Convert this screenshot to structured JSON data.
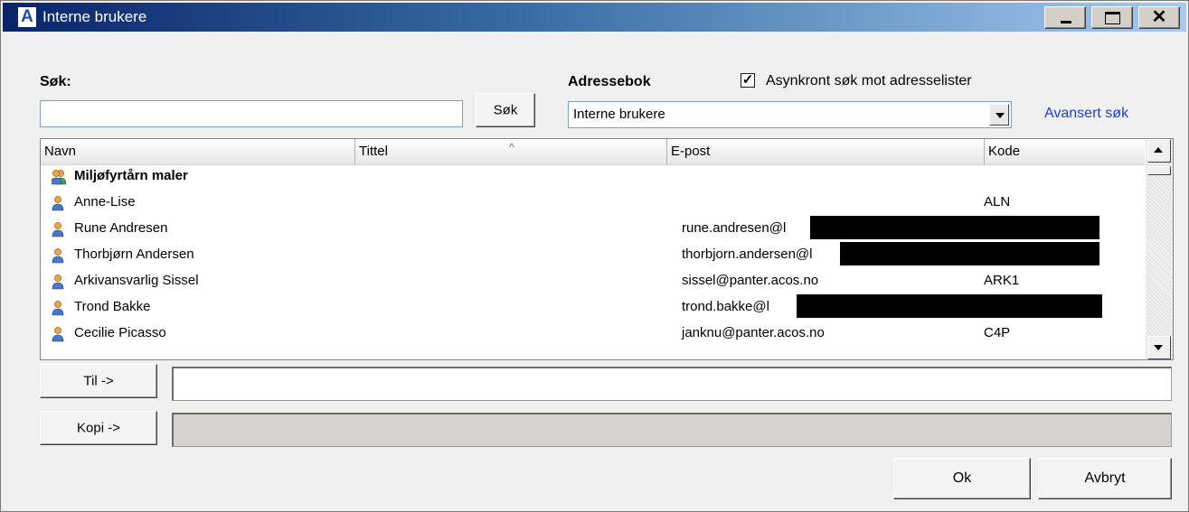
{
  "window": {
    "title": "Interne brukere",
    "icon": "acos-app-icon",
    "controls": {
      "minimize": "minimize-icon",
      "maximize": "maximize-icon",
      "close": "close-icon"
    },
    "close_glyph": "✕"
  },
  "search": {
    "label": "Søk:",
    "value": "",
    "button_label": "Søk"
  },
  "addressbook": {
    "label": "Adressebok",
    "selected": "Interne brukere",
    "async_checkbox_label": "Asynkront søk mot adresselister",
    "async_checked": true,
    "check_glyph": "✓",
    "advanced_link": "Avansert søk"
  },
  "list": {
    "columns": {
      "name": "Navn",
      "title": "Tittel",
      "email": "E-post",
      "code": "Kode"
    },
    "sort_glyph": "^",
    "rows": [
      {
        "name": "Miljøfyrtårn maler",
        "title": "",
        "email": "",
        "code": "",
        "type": "group",
        "redacted": false
      },
      {
        "name": "Anne-Lise",
        "title": "",
        "email": "",
        "code": "ALN",
        "type": "user",
        "redacted": false
      },
      {
        "name": "Rune Andresen",
        "title": "",
        "email": "rune.andresen@l",
        "code": "",
        "type": "user",
        "redacted": true
      },
      {
        "name": "Thorbjørn Andersen",
        "title": "",
        "email": "thorbjorn.andersen@l",
        "code": "",
        "type": "user",
        "redacted": true
      },
      {
        "name": "Arkivansvarlig Sissel",
        "title": "",
        "email": "sissel@panter.acos.no",
        "code": "ARK1",
        "type": "user",
        "redacted": false
      },
      {
        "name": "Trond Bakke",
        "title": "",
        "email": "trond.bakke@l",
        "code": "",
        "type": "user",
        "redacted": true
      },
      {
        "name": "Cecilie Picasso",
        "title": "",
        "email": "janknu@panter.acos.no",
        "code": "C4P",
        "type": "user",
        "redacted": false
      }
    ],
    "colors": {
      "user_icon_head": "#e8a445",
      "user_icon_body": "#4a78c9",
      "group_icon_second": "#3aa84a",
      "redaction": "#000000"
    }
  },
  "recipients": {
    "to_button": "Til ->",
    "to_value": "",
    "cc_button": "Kopi ->",
    "cc_value": ""
  },
  "footer": {
    "ok_label": "Ok",
    "cancel_label": "Avbryt"
  }
}
